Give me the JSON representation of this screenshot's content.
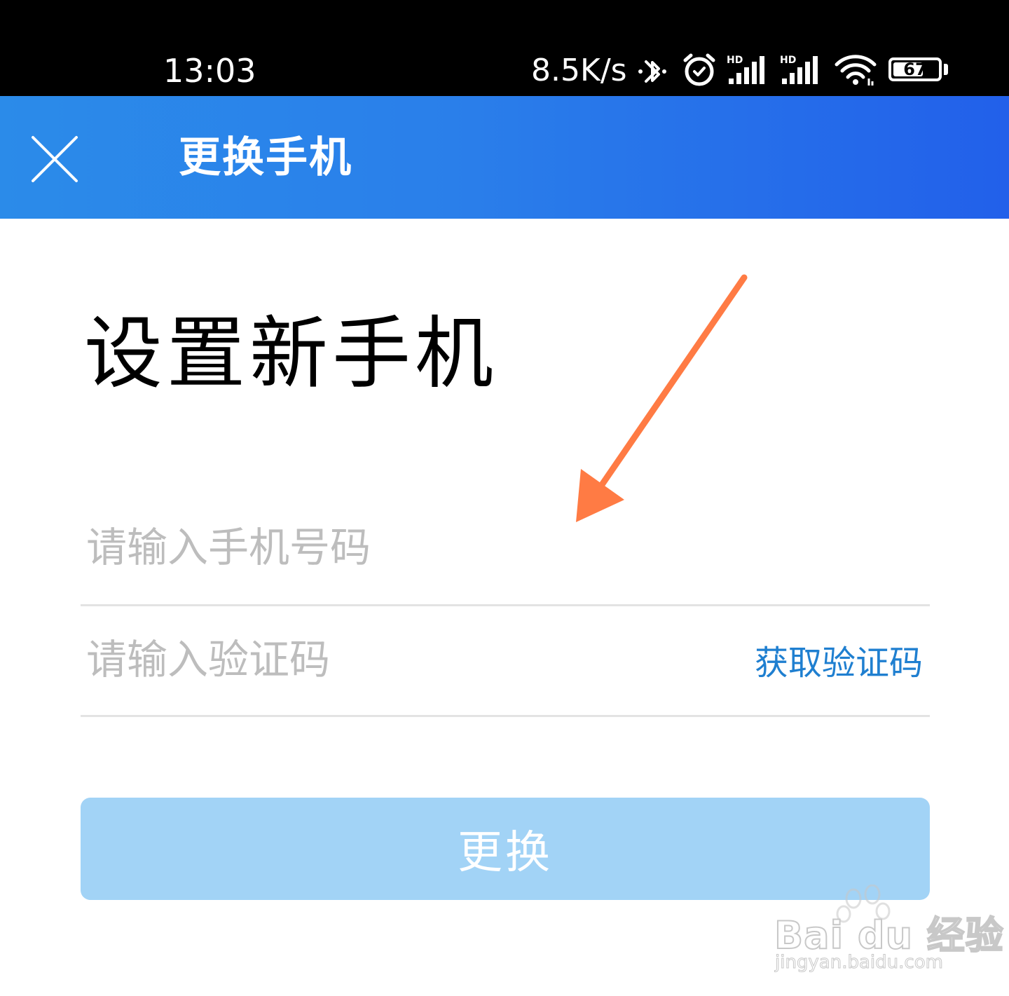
{
  "status_bar": {
    "time": "13:03",
    "network_speed": "8.5K/s",
    "battery_level": "67",
    "battery_fraction": 0.67,
    "icons": [
      "bluetooth-icon",
      "alarm-icon",
      "hd-signal-icon",
      "hd-signal-icon",
      "wifi-icon",
      "battery-icon"
    ],
    "hd_label": "HD"
  },
  "app_bar": {
    "title": "更换手机",
    "close_icon": "close-icon",
    "gradient": [
      "#2b8be9",
      "#2260ea"
    ]
  },
  "main": {
    "heading": "设置新手机",
    "phone_field": {
      "placeholder": "请输入手机号码",
      "value": ""
    },
    "code_field": {
      "placeholder": "请输入验证码",
      "value": "",
      "get_code_label": "获取验证码"
    },
    "submit_label": "更换"
  },
  "annotation": {
    "arrow_color": "#ff7b44"
  },
  "watermark": {
    "brand": "Bai du 经验",
    "url": "jingyan.baidu.com"
  },
  "colors": {
    "link": "#1f7fd0",
    "button_disabled": "#a2d3f6",
    "placeholder": "#bdbdbd",
    "divider": "#e3e3e3"
  }
}
